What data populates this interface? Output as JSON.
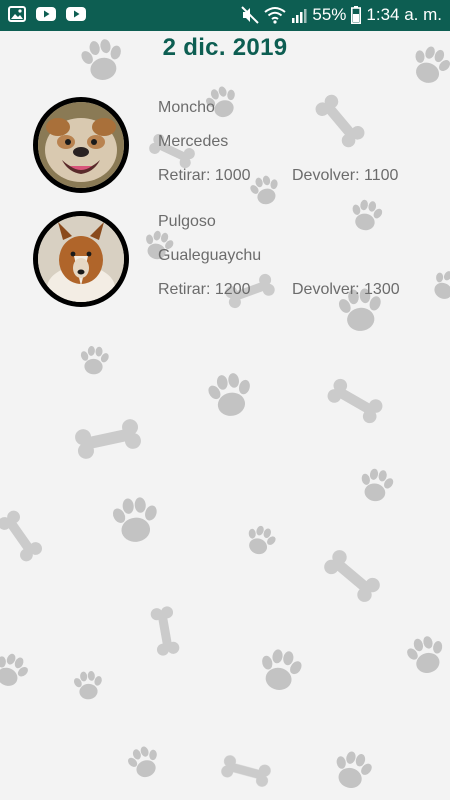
{
  "status_bar": {
    "battery": "55%",
    "time": "1:34 a. m.",
    "left_icons": [
      "image-icon",
      "youtube-icon",
      "youtube-icon"
    ],
    "right_icons": [
      "mute-icon",
      "wifi-icon",
      "signal-icon",
      "battery-icon"
    ],
    "bar_color": "#0d5e52"
  },
  "header": {
    "date": "2 dic. 2019",
    "color": "#0d5e52"
  },
  "pets": [
    {
      "name": "Moncho",
      "location": "Mercedes",
      "pickup_label": "Retirar:",
      "pickup_time": "1000",
      "return_label": "Devolver:",
      "return_time": "1100",
      "photo": "bulldog-photo"
    },
    {
      "name": "Pulgoso",
      "location": "Gualeguaychu",
      "pickup_label": "Retirar:",
      "pickup_time": "1200",
      "return_label": "Devolver:",
      "return_time": "1300",
      "photo": "sheltie-photo"
    }
  ],
  "background": {
    "pattern": "paw-prints-and-bones"
  }
}
